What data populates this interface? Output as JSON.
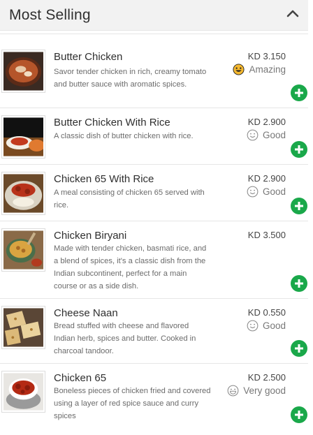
{
  "section": {
    "title": "Most Selling"
  },
  "items": [
    {
      "name": "Butter Chicken",
      "description": "Savor tender chicken in rich, creamy tomato and butter sauce with aromatic spices.",
      "price": "KD 3.150",
      "rating": "Amazing",
      "rating_icon": "amazing-face-icon"
    },
    {
      "name": "Butter Chicken With Rice",
      "description": "A classic dish of butter chicken with rice.",
      "price": "KD 2.900",
      "rating": "Good",
      "rating_icon": "smiley-face-icon"
    },
    {
      "name": "Chicken 65 With Rice",
      "description": "A meal consisting of chicken 65 served with rice.",
      "price": "KD 2.900",
      "rating": "Good",
      "rating_icon": "smiley-face-icon"
    },
    {
      "name": "Chicken Biryani",
      "description": "Made with tender chicken, basmati rice, and a blend of spices, it's a classic dish from the Indian subcontinent, perfect for a main course or as a side dish.",
      "price": "KD 3.500",
      "rating": "",
      "rating_icon": ""
    },
    {
      "name": "Cheese Naan",
      "description": "Bread stuffed with cheese and flavored Indian herb, spices and butter. Cooked in charcoal tandoor.",
      "price": "KD 0.550",
      "rating": "Good",
      "rating_icon": "smiley-face-icon"
    },
    {
      "name": "Chicken 65",
      "description": "Boneless pieces of chicken fried and covered using a layer of red spice sauce and curry spices",
      "price": "KD 2.500",
      "rating": "Very good",
      "rating_icon": "grin-face-icon"
    }
  ],
  "colors": {
    "add_button": "#1aa84a",
    "header_bg": "#f2f2f2",
    "amazing_icon": "#f5b82e"
  }
}
